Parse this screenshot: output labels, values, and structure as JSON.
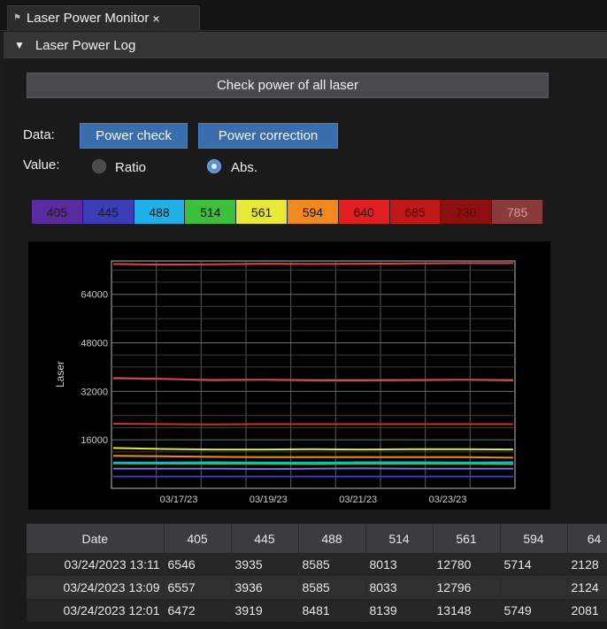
{
  "tab": {
    "title": "Laser Power Monitor",
    "close": "×",
    "icon": "laser-icon"
  },
  "panel": {
    "title": "Laser Power Log",
    "caret": "▼"
  },
  "check_button": "Check power of all laser",
  "data_row": {
    "label": "Data:",
    "power_check": "Power check",
    "power_correction": "Power correction"
  },
  "value_row": {
    "label": "Value:",
    "ratio": "Ratio",
    "abs": "Abs.",
    "selected": "Abs."
  },
  "wavelengths": [
    {
      "label": "405",
      "bg": "#5a2aa0",
      "fg": "#1a1a1a"
    },
    {
      "label": "445",
      "bg": "#3d3cb8",
      "fg": "#1a1a1a"
    },
    {
      "label": "488",
      "bg": "#1fb0e8",
      "fg": "#111111"
    },
    {
      "label": "514",
      "bg": "#3cbf3c",
      "fg": "#111111"
    },
    {
      "label": "561",
      "bg": "#e8e838",
      "fg": "#111111"
    },
    {
      "label": "594",
      "bg": "#f08a20",
      "fg": "#111111"
    },
    {
      "label": "640",
      "bg": "#e02020",
      "fg": "#3a0000"
    },
    {
      "label": "685",
      "bg": "#c01818",
      "fg": "#500000"
    },
    {
      "label": "730",
      "bg": "#8c1010",
      "fg": "#5a0000"
    },
    {
      "label": "785",
      "bg": "#8a3a3a",
      "fg": "#d0a0a0"
    }
  ],
  "chart_data": {
    "type": "line",
    "xlabel": "",
    "ylabel": "Laser",
    "x_ticks": [
      "03/17/23",
      "03/19/23",
      "03/21/23",
      "03/23/23"
    ],
    "y_ticks": [
      16000,
      32000,
      48000,
      64000
    ],
    "ylim": [
      0,
      75000
    ],
    "grid": true,
    "series": [
      {
        "color": "#d84848",
        "values": [
          74000,
          73800,
          73900,
          74100,
          74000,
          74100,
          74200,
          74300,
          74300
        ]
      },
      {
        "color": "#d84848",
        "values": [
          36400,
          36100,
          35700,
          35800,
          35600,
          35600,
          35700,
          35800,
          35600
        ]
      },
      {
        "color": "#c83030",
        "values": [
          21300,
          21200,
          21100,
          21200,
          21200,
          21200,
          21200,
          21200,
          21200
        ]
      },
      {
        "color": "#e8e838",
        "values": [
          13300,
          13000,
          12800,
          12800,
          12900,
          12800,
          12900,
          12900,
          12800
        ]
      },
      {
        "color": "#f08a20",
        "values": [
          10700,
          10600,
          10400,
          10300,
          10300,
          10300,
          10300,
          10300,
          10100
        ]
      },
      {
        "color": "#3cbf3c",
        "values": [
          8300,
          8200,
          8100,
          8100,
          8000,
          8100,
          8100,
          8100,
          8000
        ]
      },
      {
        "color": "#1fb0e8",
        "values": [
          8500,
          8500,
          8600,
          8500,
          8500,
          8600,
          8600,
          8500,
          8600
        ]
      },
      {
        "color": "#7a6ad0",
        "values": [
          6500,
          6500,
          6500,
          6400,
          6500,
          6600,
          6500,
          6500,
          6500
        ]
      },
      {
        "color": "#3d3cb8",
        "values": [
          3900,
          3900,
          3900,
          3900,
          3900,
          3900,
          3900,
          3900,
          3900
        ]
      }
    ]
  },
  "table": {
    "headers": [
      "Date",
      "405",
      "445",
      "488",
      "514",
      "561",
      "594",
      "64"
    ],
    "rows": [
      [
        "03/24/2023 13:11",
        "6546",
        "3935",
        "8585",
        "8013",
        "12780",
        "5714",
        "2128"
      ],
      [
        "03/24/2023 13:09",
        "6557",
        "3936",
        "8585",
        "8033",
        "12796",
        "",
        "2124"
      ],
      [
        "03/24/2023 12:01",
        "6472",
        "3919",
        "8481",
        "8139",
        "13148",
        "5749",
        "2081"
      ]
    ]
  }
}
